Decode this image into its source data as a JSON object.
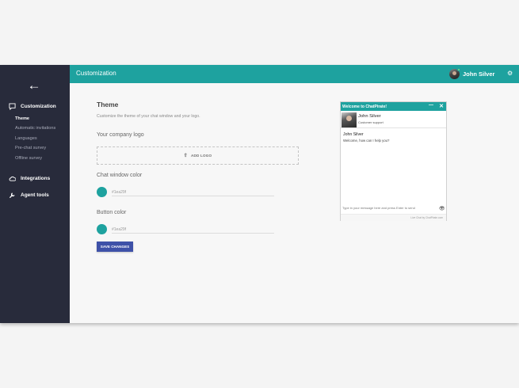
{
  "header": {
    "title": "Customization",
    "user_name": "John Silver",
    "settings_icon": "gear-icon"
  },
  "sidebar": {
    "back_icon": "arrow-left-icon",
    "items": [
      {
        "label": "Customization",
        "icon": "chat-bubble-icon"
      },
      {
        "label": "Integrations",
        "icon": "cloud-icon"
      },
      {
        "label": "Agent tools",
        "icon": "wrench-icon"
      }
    ],
    "subitems": [
      {
        "label": "Theme",
        "active": true
      },
      {
        "label": "Automatic invitations"
      },
      {
        "label": "Languages"
      },
      {
        "label": "Pre-chat survey"
      },
      {
        "label": "Offline survey"
      }
    ]
  },
  "main": {
    "title": "Theme",
    "description": "Customize the theme of your chat window and your logo.",
    "logo_label": "Your company logo",
    "add_logo": "ADD LOGO",
    "chat_color_label": "Chat window color",
    "chat_color_value": "#1ea29f",
    "button_color_label": "Button color",
    "button_color_value": "#1ea29f",
    "save_label": "SAVE CHANGES"
  },
  "chat_preview": {
    "title": "Welcome to ChatPirate!",
    "agent_name": "John Silver",
    "agent_role": "Customer support",
    "message_author": "John Silver",
    "message_text": "Welcome, how can I help you?",
    "input_placeholder": "Type in your message here and press Enter to send",
    "footer": "Live Chat by ChatPirate.com"
  },
  "colors": {
    "accent": "#1ea29f",
    "sidebar": "#282b3b",
    "button": "#3e51a8"
  }
}
